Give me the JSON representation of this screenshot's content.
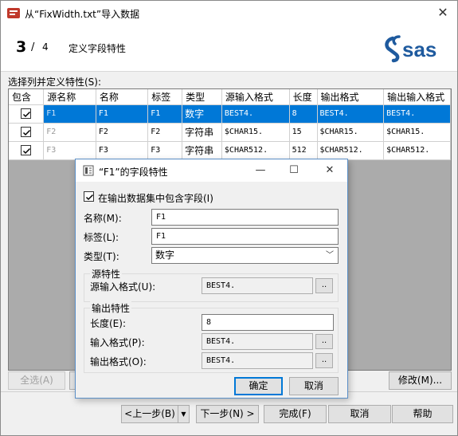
{
  "window": {
    "title": "从“FixWidth.txt”导入数据",
    "close_glyph": "✕"
  },
  "wizard": {
    "step_current": "3",
    "step_sep": "/",
    "step_total": "4",
    "step_title": "定义字段特性",
    "logo_text": "sas"
  },
  "grid": {
    "label": "选择列并定义特性(S):",
    "columns": [
      "包含",
      "源名称",
      "名称",
      "标签",
      "类型",
      "源输入格式",
      "长度",
      "输出格式",
      "输出输入格式"
    ],
    "rows": [
      {
        "included": true,
        "source": "F1",
        "name": "F1",
        "label": "F1",
        "type": "数字",
        "src_informat": "BEST4.",
        "length": "8",
        "format": "BEST4.",
        "informat": "BEST4.",
        "selected": true
      },
      {
        "included": true,
        "source": "F2",
        "name": "F2",
        "label": "F2",
        "type": "字符串",
        "src_informat": "$CHAR15.",
        "length": "15",
        "format": "$CHAR15.",
        "informat": "$CHAR15.",
        "selected": false
      },
      {
        "included": true,
        "source": "F3",
        "name": "F3",
        "label": "F3",
        "type": "字符串",
        "src_informat": "$CHAR512.",
        "length": "512",
        "format": "$CHAR512.",
        "informat": "$CHAR512.",
        "selected": false
      }
    ]
  },
  "buttons": {
    "select_all": "全选(A)",
    "modify": "修改(M)...",
    "back": "<上一步(B)",
    "next": "下一步(N) >",
    "finish": "完成(F)",
    "cancel": "取消",
    "help": "帮助",
    "back_dropdown": "▼"
  },
  "dialog": {
    "title": "“F1”的字段特性",
    "minimize": "—",
    "maximize": "☐",
    "close": "✕",
    "include_label": "在输出数据集中包含字段(I)",
    "include_checked": true,
    "name_label": "名称(M):",
    "name_value": "F1",
    "label_label": "标签(L):",
    "label_value": "F1",
    "type_label": "类型(T):",
    "type_value": "数字",
    "source_group": "源特性",
    "src_informat_label": "源输入格式(U):",
    "src_informat_value": "BEST4.",
    "output_group": "输出特性",
    "length_label": "长度(E):",
    "length_value": "8",
    "informat_label": "输入格式(P):",
    "informat_value": "BEST4.",
    "format_label": "输出格式(O):",
    "format_value": "BEST4.",
    "browse": "..",
    "ok": "确定",
    "cancel": "取消"
  }
}
